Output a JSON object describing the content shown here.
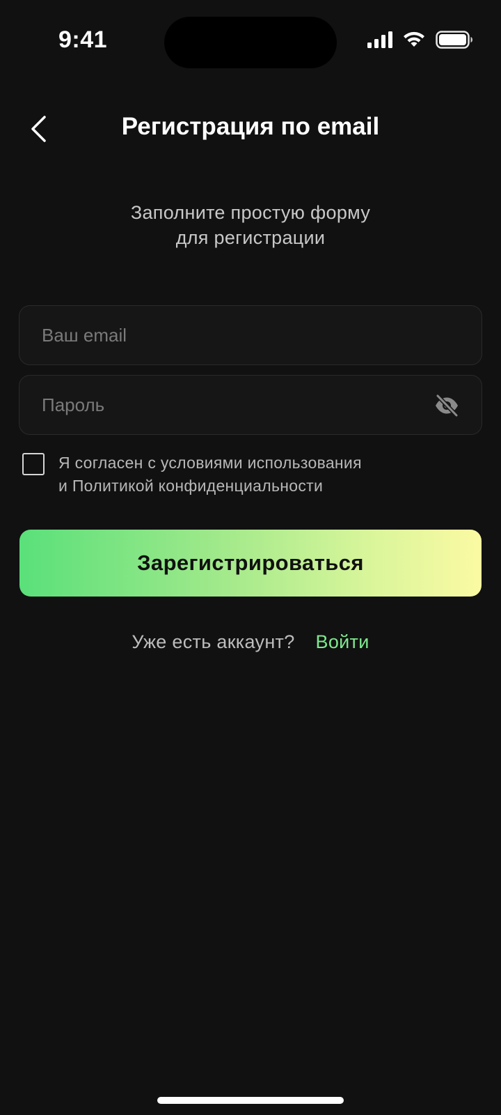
{
  "status_bar": {
    "time": "9:41",
    "icons": [
      "cellular-signal-icon",
      "wifi-icon",
      "battery-icon"
    ]
  },
  "header": {
    "back_icon": "chevron-left-icon",
    "title": "Регистрация по email"
  },
  "subtitle": {
    "line1": "Заполните простую форму",
    "line2": "для регистрации"
  },
  "form": {
    "email": {
      "placeholder": "Ваш email",
      "value": ""
    },
    "password": {
      "placeholder": "Пароль",
      "value": "",
      "toggle_icon": "eye-off-icon"
    },
    "consent": {
      "checked": false,
      "line1": "Я согласен с условиями использования",
      "line2": "и Политикой конфиденциальности"
    },
    "submit_label": "Зарегистрироваться"
  },
  "login_prompt": {
    "question": "Уже есть аккаунт?",
    "link": "Войти"
  },
  "colors": {
    "background": "#111111",
    "accent_green": "#7ee98e",
    "button_gradient_start": "#5ae07a",
    "button_gradient_end": "#fbfaa3"
  }
}
